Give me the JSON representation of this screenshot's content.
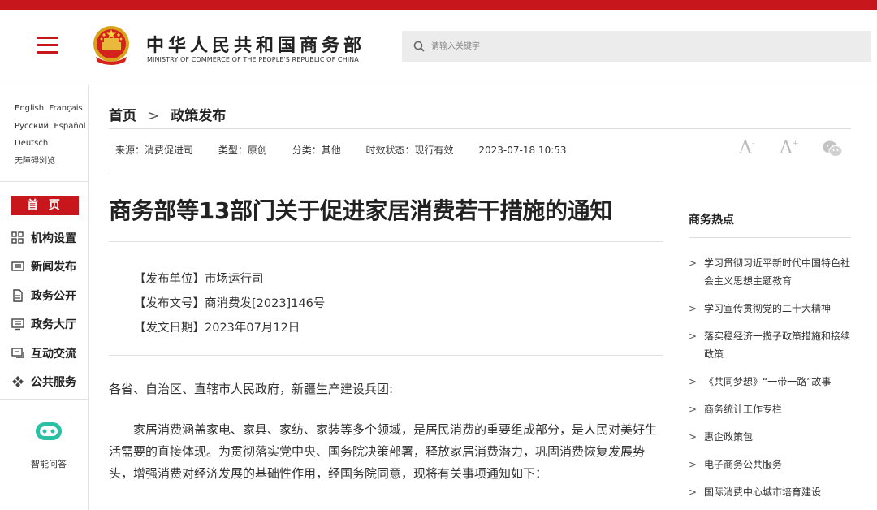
{
  "header": {
    "site_name": "中华人民共和国商务部",
    "site_name_en": "MINISTRY OF COMMERCE OF THE PEOPLE'S REPUBLIC OF CHINA",
    "search_placeholder": "请输入关键字",
    "brand_color": "#c8161d"
  },
  "sidebar": {
    "languages": [
      [
        "English",
        "Français"
      ],
      [
        "Русский",
        "Español"
      ],
      [
        "Deutsch"
      ],
      [
        "无障碍浏览"
      ]
    ],
    "home_label": "首 页",
    "nav": [
      {
        "label": "机构设置",
        "icon": "org-icon"
      },
      {
        "label": "新闻发布",
        "icon": "news-icon"
      },
      {
        "label": "政务公开",
        "icon": "document-icon"
      },
      {
        "label": "政务大厅",
        "icon": "hall-icon"
      },
      {
        "label": "互动交流",
        "icon": "chat-icon"
      },
      {
        "label": "公共服务",
        "icon": "service-icon"
      }
    ],
    "assistant_label": "智能问答"
  },
  "breadcrumb": {
    "home": "首页",
    "current": "政策发布"
  },
  "meta": {
    "source": "来源：消费促进司",
    "type": "类型：原创",
    "category": "分类：其他",
    "status": "时效状态：现行有效",
    "datetime": "2023-07-18 10:53"
  },
  "tools": {
    "font_decrease": "A",
    "font_increase": "A"
  },
  "article": {
    "title": "商务部等13部门关于促进家居消费若干措施的通知",
    "issuer": "【发布单位】市场运行司",
    "doc_number": "【发布文号】商消费发[2023]146号",
    "issue_date": "【发文日期】2023年07月12日",
    "paragraphs": [
      "各省、自治区、直辖市人民政府，新疆生产建设兵团:",
      "家居消费涵盖家电、家具、家纺、家装等多个领域，是居民消费的重要组成部分，是人民对美好生活需要的直接体现。为贯彻落实党中央、国务院决策部署，释放家居消费潜力，巩固消费恢复发展势头，增强消费对经济发展的基础性作用，经国务院同意，现将有关事项通知如下："
    ]
  },
  "hot": {
    "title": "商务热点",
    "items": [
      "学习贯彻习近平新时代中国特色社会主义思想主题教育",
      "学习宣传贯彻党的二十大精神",
      "落实稳经济一揽子政策措施和接续政策",
      "《共同梦想》“一带一路”故事",
      "商务统计工作专栏",
      "惠企政策包",
      "电子商务公共服务",
      "国际消费中心城市培育建设"
    ]
  }
}
